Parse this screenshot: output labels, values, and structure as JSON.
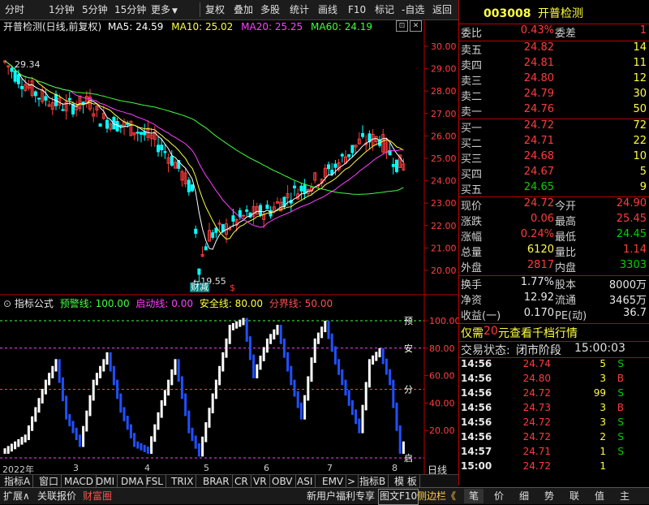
{
  "toolbar": {
    "periods": [
      "分时",
      "1分钟",
      "5分钟",
      "15分钟"
    ],
    "more": "更多",
    "buttons": [
      "复权",
      "叠加",
      "多股",
      "统计",
      "画线",
      "F10",
      "标记",
      "-自选",
      "返回"
    ]
  },
  "chart_header": {
    "title": "开普检测(日线,前复权)",
    "ma5": "MA5: 24.59",
    "ma10": "MA10: 25.02",
    "ma20": "MA20: 25.25",
    "ma60": "MA60: 24.19"
  },
  "main_chart": {
    "price_ticks": [
      "30.00",
      "29.00",
      "28.00",
      "27.00",
      "26.00",
      "25.00",
      "24.00",
      "23.00",
      "22.00",
      "21.00",
      "20.00"
    ],
    "high_label": "29.34",
    "low_label": "←19.55",
    "marker_label": "财减",
    "marker_s": "$"
  },
  "indicator": {
    "name": "指标公式",
    "warn": "预警线: 100.00",
    "start": "启动线: 0.00",
    "safe": "安全线: 80.00",
    "boundary": "分界线: 50.00",
    "ticks": [
      "100.00",
      "80.00",
      "60.00",
      "40.00",
      "20.00"
    ],
    "line_tags": [
      "预",
      "安",
      "分",
      "启"
    ]
  },
  "x_axis": {
    "labels": [
      "2022年",
      "3",
      "4",
      "5",
      "6",
      "7",
      "8"
    ],
    "period": "日线"
  },
  "indicator_tabs": [
    "指标A",
    "窗口",
    "MACD",
    "DMI",
    "DMA",
    "FSL",
    "TRIX",
    "BRAR",
    "CR",
    "VR",
    "OBV",
    "ASI",
    "EMV",
    ">",
    "指标B",
    "模 板"
  ],
  "bottom_tabs": {
    "left": [
      "扩展∧",
      "关联报价",
      "财富圈"
    ],
    "promo": "新用户福利专享",
    "f10": "图文F10",
    "side": "侧边栏《",
    "right": [
      "笔",
      "价",
      "细",
      "势",
      "联",
      "值",
      "主"
    ]
  },
  "stock": {
    "code": "003008",
    "name": "开普检测"
  },
  "order_book": {
    "weibi_label": "委比",
    "weibi_value": "0.43%",
    "weicha_label": "委差",
    "weicha_value": "1",
    "asks": [
      {
        "label": "卖五",
        "price": "24.82",
        "vol": "14"
      },
      {
        "label": "卖四",
        "price": "24.81",
        "vol": "11"
      },
      {
        "label": "卖三",
        "price": "24.80",
        "vol": "12"
      },
      {
        "label": "卖二",
        "price": "24.79",
        "vol": "30"
      },
      {
        "label": "卖一",
        "price": "24.76",
        "vol": "50"
      }
    ],
    "bids": [
      {
        "label": "买一",
        "price": "24.72",
        "vol": "72"
      },
      {
        "label": "买二",
        "price": "24.71",
        "vol": "22"
      },
      {
        "label": "买三",
        "price": "24.68",
        "vol": "10"
      },
      {
        "label": "买四",
        "price": "24.67",
        "vol": "5"
      },
      {
        "label": "买五",
        "price": "24.65",
        "vol": "9"
      }
    ]
  },
  "quote": [
    {
      "l1": "现价",
      "v1": "24.72",
      "l2": "今开",
      "v2": "24.90",
      "c1": "red",
      "c2": "red"
    },
    {
      "l1": "涨跌",
      "v1": "0.06",
      "l2": "最高",
      "v2": "25.45",
      "c1": "red",
      "c2": "red"
    },
    {
      "l1": "涨幅",
      "v1": "0.24%",
      "l2": "最低",
      "v2": "24.45",
      "c1": "red",
      "c2": "grn"
    },
    {
      "l1": "总量",
      "v1": "6120",
      "l2": "量比",
      "v2": "1.14",
      "c1": "yel",
      "c2": "red"
    },
    {
      "l1": "外盘",
      "v1": "2817",
      "l2": "内盘",
      "v2": "3303",
      "c1": "red",
      "c2": "grn"
    }
  ],
  "stats": [
    {
      "l1": "换手",
      "v1": "1.77%",
      "l2": "股本",
      "v2": "8000万"
    },
    {
      "l1": "净资",
      "v1": "12.92",
      "l2": "流通",
      "v2": "3465万"
    },
    {
      "l1": "收益(一)",
      "v1": "0.170",
      "l2": "PE(动)",
      "v2": "36.7"
    }
  ],
  "promo_line": {
    "prefix": "仅需",
    "num": "20",
    "suffix": "元查看千档行情"
  },
  "trade_status": {
    "label": "交易状态:",
    "status": "闭市阶段",
    "time": "15:00:03"
  },
  "ticks": [
    {
      "time": "14:56",
      "price": "24.74",
      "vol": "5",
      "side": "S"
    },
    {
      "time": "14:56",
      "price": "24.80",
      "vol": "3",
      "side": "B"
    },
    {
      "time": "14:56",
      "price": "24.72",
      "vol": "99",
      "side": "S"
    },
    {
      "time": "14:56",
      "price": "24.73",
      "vol": "3",
      "side": "B"
    },
    {
      "time": "14:56",
      "price": "24.72",
      "vol": "3",
      "side": "S"
    },
    {
      "time": "14:56",
      "price": "24.72",
      "vol": "2",
      "side": "S"
    },
    {
      "time": "14:57",
      "price": "24.71",
      "vol": "1",
      "side": "S"
    },
    {
      "time": "15:00",
      "price": "24.72",
      "vol": "1",
      "side": ""
    }
  ]
}
